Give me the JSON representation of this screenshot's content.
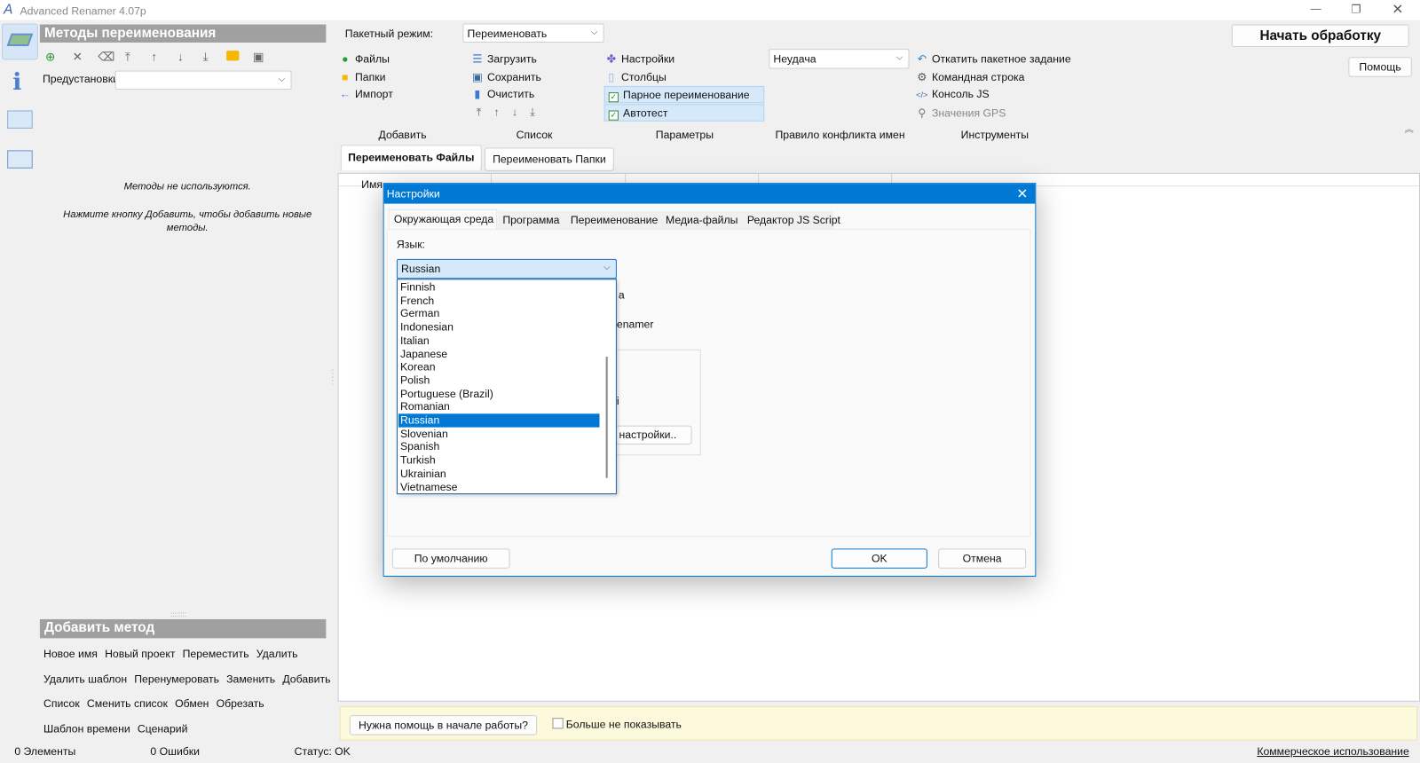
{
  "app": {
    "title": "Advanced Renamer 4.07p",
    "logo_icon": "ar-logo-icon"
  },
  "window_controls": [
    "minimize",
    "restore",
    "close"
  ],
  "sidebar_icons": [
    "methods-layers-icon",
    "info-icon",
    "image-icon",
    "folder-icon"
  ],
  "methods_panel": {
    "title": "Методы переименования",
    "toolbar": [
      "add-icon",
      "remove-icon",
      "clear-icon",
      "move-top-icon",
      "move-up-icon",
      "move-down-icon",
      "move-bottom-icon",
      "open-folder-icon",
      "save-icon"
    ],
    "presets_label": "Предустановки",
    "presets_value": "",
    "empty_line1": "Методы не используются.",
    "empty_line2": "Нажмите кнопку Добавить, чтобы добавить новые методы."
  },
  "add_method": {
    "title": "Добавить метод",
    "rows": [
      [
        "Новое имя",
        "Новый проект",
        "Переместить",
        "Удалить"
      ],
      [
        "Удалить шаблон",
        "Перенумеровать",
        "Заменить",
        "Добавить"
      ],
      [
        "Список",
        "Сменить список",
        "Обмен",
        "Обрезать"
      ],
      [
        "Шаблон времени",
        "Сценарий"
      ]
    ]
  },
  "ribbon": {
    "batch_label": "Пакетный режим:",
    "batch_value": "Переименовать",
    "add": {
      "label": "Добавить",
      "items": [
        "Файлы",
        "Папки",
        "Импорт"
      ]
    },
    "list": {
      "label": "Список",
      "items": [
        "Загрузить",
        "Сохранить",
        "Очистить"
      ]
    },
    "params": {
      "label": "Параметры",
      "items": [
        "Настройки",
        "Столбцы",
        "Парное переименование",
        "Автотест"
      ],
      "pair_checked": true,
      "autotest_checked": true
    },
    "conflict": {
      "label": "Правило конфликта имен",
      "value": "Неудача"
    },
    "tools": {
      "label": "Инструменты",
      "items": [
        "Откатить пакетное задание",
        "Командная строка",
        "Консоль JS",
        "Значения GPS"
      ]
    },
    "start": "Начать обработку",
    "help": "Помощь"
  },
  "main_tabs": [
    "Переименовать Файлы",
    "Переименовать Папки"
  ],
  "columns": [
    "Имя"
  ],
  "help_bar": {
    "button": "Нужна помощь в начале работы?",
    "checkbox": "Больше не показывать",
    "checked": false,
    "bg": "#fdf9dc"
  },
  "status": {
    "items": "0 Элементы",
    "errors": "0 Ошибки",
    "status": "Статус: OK",
    "license": "Коммерческое использование"
  },
  "dialog": {
    "title": "Настройки",
    "tabs": [
      "Окружающая среда",
      "Программа",
      "Переименование",
      "Медиа-файлы",
      "Редактор JS Script"
    ],
    "active_tab": "Окружающая среда",
    "language_label": "Язык:",
    "language_value": "Russian",
    "languages": [
      "Finnish",
      "French",
      "German",
      "Indonesian",
      "Italian",
      "Japanese",
      "Korean",
      "Polish",
      "Portuguese (Brazil)",
      "Romanian",
      "Russian",
      "Slovenian",
      "Spanish",
      "Turkish",
      "Ukrainian",
      "Vietnamese"
    ],
    "selected": "Russian",
    "hidden_text": {
      "a": "а",
      "b": "enamer",
      "c": "i",
      "btn": "настройки.."
    },
    "default_btn": "По умолчанию",
    "ok": "OK",
    "cancel": "Отмена",
    "accent": "#0078d4"
  }
}
